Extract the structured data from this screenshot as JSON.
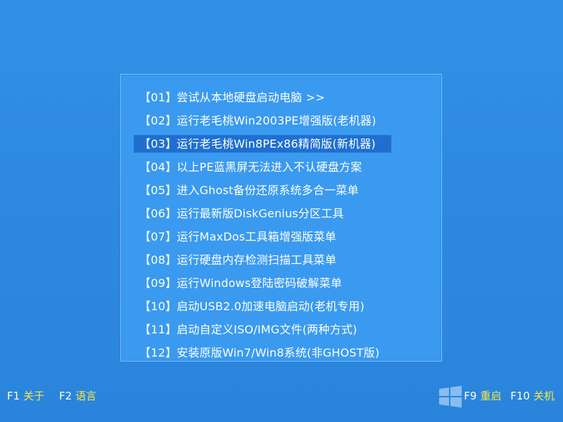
{
  "menu": {
    "items": [
      {
        "label": "【01】尝试从本地硬盘启动电脑 >>"
      },
      {
        "label": "【02】运行老毛桃Win2003PE增强版(老机器)"
      },
      {
        "label": "【03】运行老毛桃Win8PEx86精简版(新机器)",
        "selected": true
      },
      {
        "label": "【04】以上PE蓝黑屏无法进入不认硬盘方案"
      },
      {
        "label": "【05】进入Ghost备份还原系统多合一菜单"
      },
      {
        "label": "【06】运行最新版DiskGenius分区工具"
      },
      {
        "label": "【07】运行MaxDos工具箱增强版菜单"
      },
      {
        "label": "【08】运行硬盘内存检测扫描工具菜单"
      },
      {
        "label": "【09】运行Windows登陆密码破解菜单"
      },
      {
        "label": "【10】启动USB2.0加速电脑启动(老机专用)"
      },
      {
        "label": "【11】启动自定义ISO/IMG文件(两种方式)"
      },
      {
        "label": "【12】安装原版Win7/Win8系统(非GHOST版)"
      }
    ]
  },
  "footer": {
    "left": [
      {
        "key": "F1",
        "label": "关于"
      },
      {
        "key": "F2",
        "label": "语言"
      }
    ],
    "right": [
      {
        "key": "F9",
        "label": "重启"
      },
      {
        "key": "F10",
        "label": "关机"
      }
    ]
  },
  "icons": {
    "watermark": "windows-logo-icon"
  },
  "colors": {
    "background": "#2f8ae0",
    "panel": "#3a9af0",
    "selected_row": "#1f6fd0",
    "key_label": "#f6e84a"
  }
}
